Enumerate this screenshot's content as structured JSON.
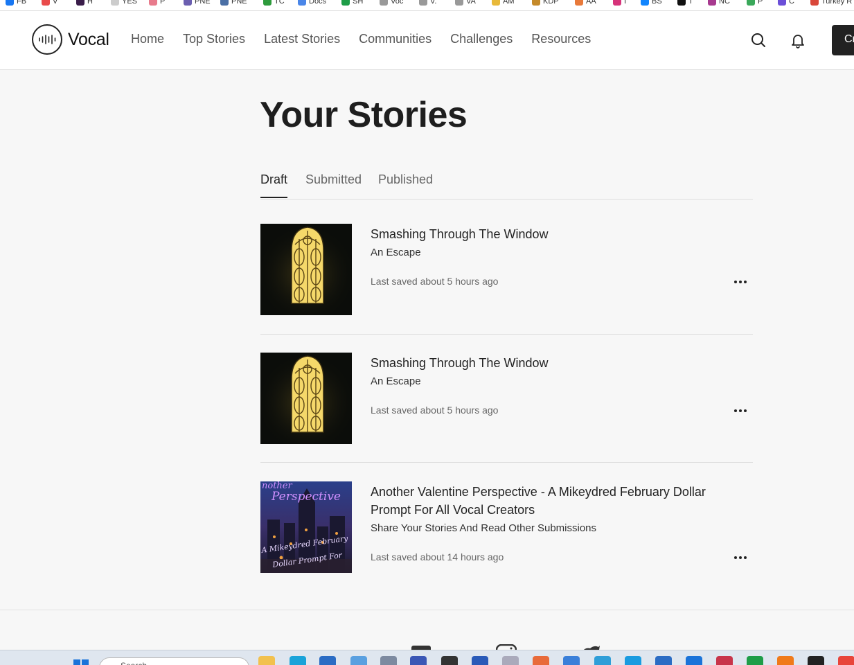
{
  "bookmarks": [
    {
      "label": "FB",
      "color": "#1877f2"
    },
    {
      "label": "V",
      "color": "#e94b4b"
    },
    {
      "label": "H",
      "color": "#3a1d4a"
    },
    {
      "label": "YES",
      "color": "#cccccc"
    },
    {
      "label": "P",
      "color": "#e87b8c"
    },
    {
      "label": "PNE",
      "color": "#6b5fb0"
    },
    {
      "label": "PNE",
      "color": "#4a6fa5"
    },
    {
      "label": "TC",
      "color": "#2e9b3c"
    },
    {
      "label": "Docs",
      "color": "#4a86e8"
    },
    {
      "label": "SH",
      "color": "#1e9d48"
    },
    {
      "label": "Voc",
      "color": "#999999"
    },
    {
      "label": "V.",
      "color": "#999999"
    },
    {
      "label": "VA",
      "color": "#999999"
    },
    {
      "label": "AM",
      "color": "#e8b93a"
    },
    {
      "label": "KDP",
      "color": "#c58a2a"
    },
    {
      "label": "AA",
      "color": "#e8793a"
    },
    {
      "label": "I",
      "color": "#d6337a"
    },
    {
      "label": "BS",
      "color": "#1185fe"
    },
    {
      "label": "T",
      "color": "#111111"
    },
    {
      "label": "NC",
      "color": "#a73a8f"
    },
    {
      "label": "P",
      "color": "#3aa85a"
    },
    {
      "label": "C",
      "color": "#6b4fd8"
    },
    {
      "label": "Turkey R",
      "color": "#d9473a"
    }
  ],
  "header": {
    "logo_text": "Vocal",
    "nav": [
      "Home",
      "Top Stories",
      "Latest Stories",
      "Communities",
      "Challenges",
      "Resources"
    ],
    "create_label": "Create",
    "icons": [
      "search-icon",
      "bell-icon"
    ]
  },
  "page": {
    "title": "Your Stories",
    "tabs": [
      {
        "label": "Draft",
        "active": true
      },
      {
        "label": "Submitted",
        "active": false
      },
      {
        "label": "Published",
        "active": false
      }
    ]
  },
  "stories": [
    {
      "title": "Smashing Through The Window",
      "subtitle": "An Escape",
      "saved": "Last saved about 5 hours ago",
      "image": "glowing-window"
    },
    {
      "title": "Smashing Through The Window",
      "subtitle": "An Escape",
      "saved": "Last saved about 5 hours ago",
      "image": "glowing-window"
    },
    {
      "title": "Another Valentine Perspective - A Mikeydred February Dollar Prompt For All Vocal Creators",
      "subtitle": "Share Your Stories And Read Other Submissions",
      "saved": "Last saved about 14 hours ago",
      "image": "valentine-castle",
      "thumb_text": [
        "nother",
        "Perspective",
        "A Mikeydred February",
        "Dollar Prompt For"
      ]
    }
  ],
  "footer": {
    "social_icons": [
      "facebook-icon",
      "instagram-icon",
      "twitter-icon"
    ]
  },
  "taskbar": {
    "search_placeholder": "Search"
  }
}
